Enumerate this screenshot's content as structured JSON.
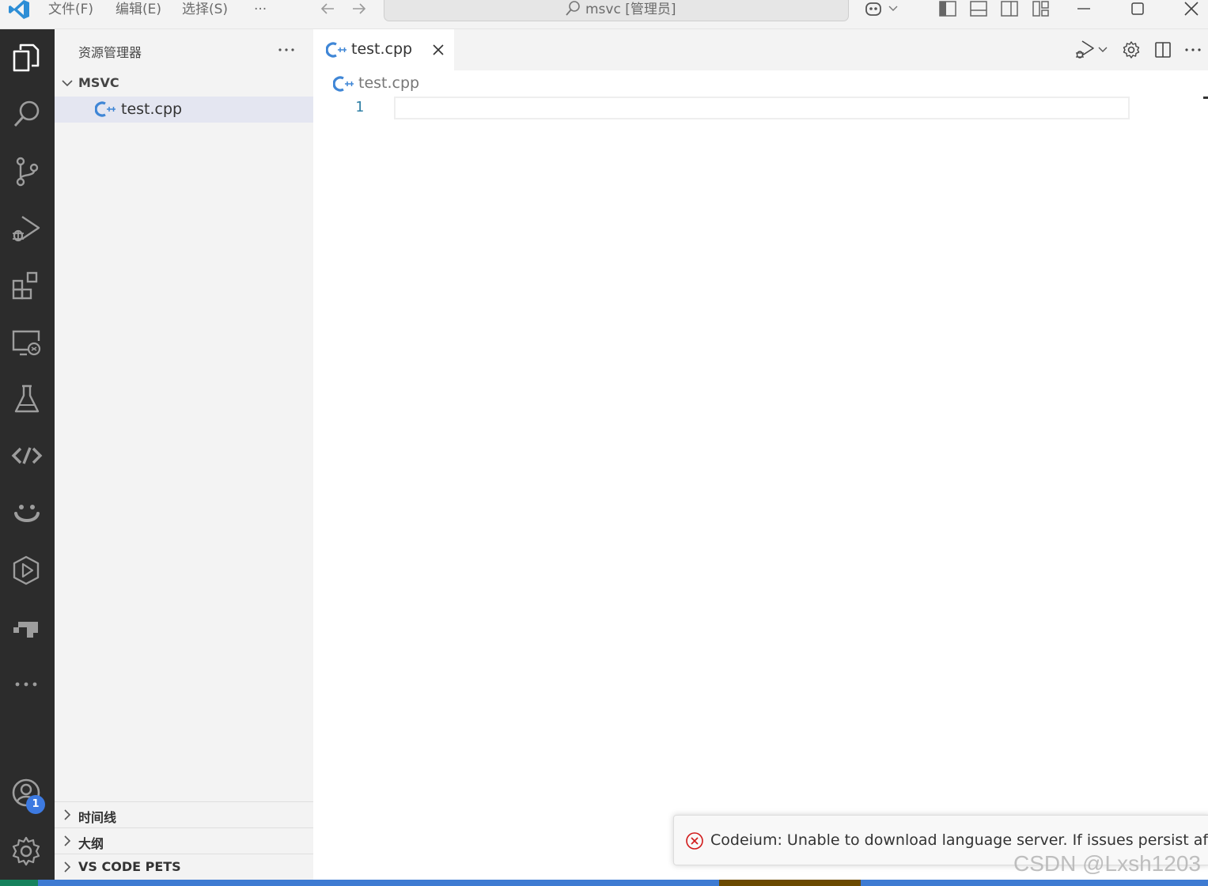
{
  "titlebar": {
    "menus": [
      "文件(F)",
      "编辑(E)",
      "选择(S)"
    ],
    "more_label": "···",
    "command_center": "msvc [管理员]"
  },
  "activity_bar": {
    "accounts_badge": "1"
  },
  "sidebar": {
    "title": "资源管理器",
    "more_label": "···",
    "folder_name": "MSVC",
    "files": [
      "test.cpp"
    ],
    "sections": [
      "时间线",
      "大纲",
      "VS CODE PETS"
    ]
  },
  "editor": {
    "tab_label": "test.cpp",
    "breadcrumb": "test.cpp",
    "line_numbers": [
      "1"
    ]
  },
  "notification": {
    "message": "Codeium: Unable to download language server. If issues persist after r..."
  },
  "watermark": "CSDN @Lxsh1203",
  "colors": {
    "activity_bar": "#2c2c2c",
    "sidebar": "#f3f3f3",
    "status_bar": "#3e7bd2",
    "cpp_icon": "#3f86d6",
    "error": "#d11a1a",
    "badge": "#3d7ae1"
  },
  "icons": {
    "activity": [
      "explorer-icon",
      "search-icon",
      "source-control-icon",
      "run-debug-icon",
      "extensions-icon",
      "remote-explorer-icon",
      "testing-icon",
      "codeium-icon",
      "copilot-icon",
      "video-icon",
      "docker-icon",
      "more-icon",
      "accounts-icon",
      "settings-gear-icon"
    ]
  }
}
